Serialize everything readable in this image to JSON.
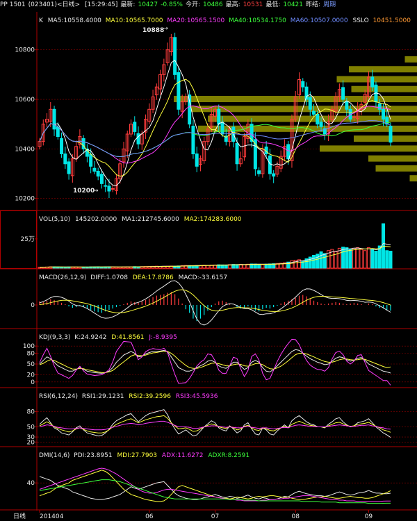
{
  "header": {
    "code": "PP  1501",
    "sub": "(023401)<日线>",
    "time": "[15:29:45]",
    "latest_label": "最新:",
    "latest": "10427",
    "change": "-0.85%",
    "open_label": "今开:",
    "open": "10486",
    "high_label": "最高:",
    "high": "10531",
    "low_label": "最低:",
    "low": "10421",
    "prev_label": "昨结:",
    "prev": "周期"
  },
  "colors": {
    "up": "#ff3c3c",
    "down": "#00e6e6",
    "ma5": "#ffffff",
    "ma10": "#ffff3c",
    "ma20": "#ff3cff",
    "ma40": "#3cff3c",
    "ma60": "#6f8cff",
    "grid": "#8b0000",
    "frame": "#b00000",
    "volume_profile": "#7f7f00"
  },
  "chart_data": [
    {
      "type": "candlestick",
      "legend": {
        "k": "K",
        "ma5": "MA5:10558.4000",
        "ma10": "MA10:10565.7000",
        "ma20": "MA20:10565.1500",
        "ma40": "MA40:10534.1750",
        "ma60": "MA60:10507.0000",
        "sslo": "SSLO",
        "sslo_value": "10451.5000"
      },
      "ylim": [
        10160,
        10900
      ],
      "yticks": [
        "10800",
        "10600",
        "10400",
        "10200"
      ],
      "ytick_values": [
        10800,
        10600,
        10400,
        10200
      ],
      "annotations": {
        "high": "10888",
        "high_value": 10888,
        "low": "10200",
        "low_value": 10200
      },
      "close_path": [
        10430,
        10500,
        10520,
        10560,
        10480,
        10450,
        10380,
        10340,
        10300,
        10360,
        10410,
        10450,
        10400,
        10370,
        10330,
        10310,
        10290,
        10260,
        10250,
        10230,
        10240,
        10280,
        10340,
        10400,
        10460,
        10500,
        10470,
        10420,
        10460,
        10520,
        10560,
        10610,
        10650,
        10700,
        10740,
        10800,
        10850,
        10700,
        10560,
        10590,
        10610,
        10500,
        10380,
        10330,
        10360,
        10430,
        10480,
        10540,
        10560,
        10500,
        10460,
        10430,
        10480,
        10430,
        10340,
        10360,
        10450,
        10500,
        10430,
        10320,
        10300,
        10400,
        10380,
        10300,
        10290,
        10330,
        10370,
        10410,
        10360,
        10520,
        10610,
        10680,
        10650,
        10600,
        10560,
        10540,
        10500,
        10490,
        10460,
        10510,
        10560,
        10610,
        10640,
        10600,
        10560,
        10520,
        10530,
        10560,
        10580,
        10620,
        10690,
        10650,
        10590,
        10560,
        10520,
        10500,
        10427
      ],
      "vol_profile_prices": [
        10760,
        10720,
        10680,
        10640,
        10600,
        10560,
        10520,
        10480,
        10440,
        10400,
        10360,
        10320,
        10280
      ],
      "vol_profile_lengths": [
        0.05,
        0.28,
        0.33,
        0.27,
        1.0,
        0.93,
        0.86,
        0.9,
        0.26,
        0.4,
        0.2,
        0.17,
        0.03
      ]
    },
    {
      "type": "bar",
      "legend": {
        "name": "VOL(5,10)",
        "value": "145202.0000",
        "ma1": "MA1:212745.6000",
        "ma2": "MA2:174283.6000"
      },
      "ylim": [
        0,
        380000
      ],
      "yticks": [
        "25万"
      ],
      "ytick_values": [
        250000
      ],
      "volumes": [
        8000,
        9000,
        10000,
        12000,
        11000,
        10000,
        9000,
        9000,
        10000,
        10000,
        10000,
        9000,
        9000,
        10000,
        11000,
        11000,
        12000,
        10000,
        11000,
        12000,
        11000,
        10000,
        9000,
        11000,
        12000,
        11000,
        13000,
        12000,
        13000,
        14000,
        15000,
        16000,
        17000,
        15000,
        16000,
        17000,
        18000,
        17000,
        19000,
        22000,
        23000,
        22000,
        21000,
        22000,
        23000,
        25000,
        24000,
        26000,
        27000,
        29000,
        28000,
        27000,
        30000,
        32000,
        31000,
        33000,
        30000,
        34000,
        36000,
        35000,
        33000,
        30000,
        34000,
        36000,
        38000,
        40000,
        42000,
        46000,
        52000,
        64000,
        68000,
        72000,
        60000,
        80000,
        95000,
        110000,
        120000,
        140000,
        125000,
        150000,
        160000,
        140000,
        170000,
        180000,
        175000,
        160000,
        170000,
        175000,
        160000,
        150000,
        175000,
        160000,
        145000,
        190000,
        380000,
        150000,
        145202
      ]
    },
    {
      "type": "bar",
      "legend": {
        "name": "MACD(26,12,9)",
        "diff": "DIFF:1.0708",
        "dea": "DEA:17.8786",
        "macd": "MACD:-33.6157"
      },
      "ylim": [
        -60,
        60
      ],
      "yticks": [
        "0"
      ],
      "ytick_values": [
        0
      ],
      "macd": [
        10,
        8,
        12,
        16,
        14,
        10,
        6,
        2,
        -4,
        -8,
        -6,
        -2,
        -6,
        -10,
        -14,
        -18,
        -20,
        -22,
        -18,
        -14,
        -10,
        -6,
        -2,
        2,
        6,
        10,
        8,
        6,
        10,
        14,
        18,
        22,
        26,
        28,
        30,
        34,
        36,
        30,
        18,
        4,
        -12,
        -22,
        -38,
        -45,
        -38,
        -28,
        -16,
        -6,
        4,
        10,
        12,
        8,
        4,
        0,
        -6,
        -10,
        -8,
        -4,
        -10,
        -16,
        -18,
        -12,
        -8,
        -10,
        -6,
        -2,
        4,
        8,
        12,
        16,
        20,
        26,
        28,
        24,
        18,
        12,
        8,
        4,
        2,
        4,
        6,
        8,
        6,
        4,
        2,
        4,
        6,
        4,
        2,
        0,
        4,
        2,
        -4,
        -8,
        -10,
        -14,
        -16
      ]
    },
    {
      "type": "line",
      "legend": {
        "name": "KDJ(9,3,3)",
        "k": "K:24.9242",
        "d": "D:41.8561",
        "j": "J:-8.9395"
      },
      "ylim": [
        -10,
        110
      ],
      "yticks": [
        "100",
        "80",
        "50",
        "20",
        "0"
      ],
      "ytick_values": [
        100,
        80,
        50,
        20,
        0
      ],
      "k": [
        50,
        60,
        70,
        65,
        55,
        45,
        40,
        35,
        30,
        30,
        35,
        40,
        35,
        30,
        28,
        26,
        25,
        24,
        26,
        30,
        40,
        55,
        65,
        75,
        80,
        85,
        80,
        70,
        72,
        78,
        82,
        85,
        85,
        86,
        88,
        84,
        70,
        55,
        40,
        35,
        30,
        30,
        34,
        40,
        45,
        50,
        58,
        60,
        55,
        45,
        40,
        38,
        45,
        55,
        55,
        45,
        35,
        40,
        55,
        60,
        55,
        40,
        30,
        28,
        35,
        45,
        55,
        65,
        75,
        85,
        90,
        88,
        80,
        72,
        65,
        60,
        55,
        52,
        48,
        50,
        58,
        66,
        70,
        68,
        62,
        58,
        60,
        66,
        68,
        60,
        50,
        45,
        40,
        35,
        30,
        28,
        24.92
      ],
      "d": [
        48,
        52,
        58,
        62,
        60,
        55,
        50,
        45,
        40,
        36,
        36,
        38,
        37,
        34,
        32,
        30,
        28,
        26,
        26,
        28,
        32,
        40,
        48,
        56,
        64,
        72,
        76,
        74,
        73,
        75,
        78,
        81,
        82,
        84,
        85,
        85,
        80,
        72,
        62,
        54,
        46,
        40,
        38,
        38,
        40,
        44,
        48,
        52,
        53,
        51,
        48,
        45,
        45,
        48,
        50,
        49,
        45,
        44,
        47,
        51,
        52,
        48,
        42,
        37,
        36,
        39,
        44,
        51,
        59,
        68,
        76,
        80,
        80,
        78,
        74,
        70,
        65,
        61,
        57,
        55,
        55,
        58,
        62,
        64,
        64,
        62,
        61,
        62,
        64,
        63,
        59,
        55,
        51,
        47,
        43,
        40,
        41.86
      ],
      "j": [
        54,
        76,
        94,
        71,
        45,
        25,
        20,
        15,
        10,
        18,
        33,
        44,
        31,
        22,
        20,
        18,
        19,
        20,
        26,
        34,
        56,
        85,
        99,
        113,
        112,
        111,
        88,
        62,
        70,
        84,
        90,
        93,
        91,
        90,
        94,
        82,
        50,
        21,
        -4,
        -3,
        -2,
        10,
        26,
        44,
        55,
        62,
        78,
        76,
        59,
        33,
        24,
        24,
        45,
        69,
        65,
        37,
        15,
        32,
        71,
        78,
        61,
        24,
        6,
        10,
        33,
        57,
        77,
        93,
        107,
        119,
        118,
        104,
        80,
        60,
        47,
        40,
        35,
        34,
        30,
        40,
        64,
        82,
        86,
        76,
        58,
        50,
        58,
        74,
        76,
        54,
        32,
        25,
        18,
        11,
        4,
        4,
        -8.94
      ]
    },
    {
      "type": "line",
      "legend": {
        "name": "RSI(6,12,24)",
        "rsi1": "RSI1:29.1231",
        "rsi2": "RSI2:39.2596",
        "rsi3": "RSI3:45.5936"
      },
      "ylim": [
        15,
        100
      ],
      "yticks": [
        "80",
        "50",
        "30",
        "20"
      ],
      "ytick_values": [
        80,
        50,
        30,
        20
      ],
      "rsi1": [
        55,
        62,
        68,
        58,
        48,
        44,
        38,
        36,
        34,
        40,
        48,
        52,
        44,
        38,
        36,
        34,
        32,
        33,
        38,
        45,
        55,
        62,
        66,
        70,
        74,
        76,
        68,
        60,
        66,
        72,
        76,
        78,
        80,
        82,
        84,
        74,
        58,
        46,
        36,
        40,
        44,
        38,
        32,
        34,
        42,
        50,
        56,
        62,
        58,
        48,
        44,
        42,
        52,
        46,
        38,
        42,
        54,
        58,
        46,
        36,
        34,
        48,
        44,
        36,
        34,
        42,
        48,
        54,
        48,
        62,
        68,
        72,
        66,
        60,
        56,
        54,
        50,
        50,
        48,
        55,
        60,
        66,
        68,
        60,
        54,
        50,
        52,
        58,
        60,
        62,
        66,
        58,
        50,
        44,
        38,
        34,
        29.12
      ],
      "rsi2": [
        52,
        56,
        60,
        56,
        50,
        47,
        44,
        42,
        40,
        42,
        46,
        48,
        45,
        42,
        40,
        39,
        38,
        38,
        40,
        44,
        50,
        55,
        58,
        61,
        64,
        66,
        62,
        58,
        61,
        64,
        66,
        68,
        70,
        71,
        72,
        67,
        58,
        52,
        46,
        47,
        48,
        45,
        41,
        42,
        46,
        50,
        53,
        56,
        54,
        50,
        48,
        47,
        51,
        48,
        44,
        46,
        51,
        53,
        48,
        44,
        43,
        48,
        46,
        43,
        42,
        45,
        48,
        51,
        48,
        55,
        58,
        61,
        58,
        55,
        53,
        52,
        50,
        50,
        49,
        52,
        55,
        58,
        59,
        56,
        53,
        51,
        52,
        55,
        56,
        57,
        59,
        55,
        51,
        48,
        44,
        42,
        39.26
      ],
      "rsi3": [
        50,
        52,
        54,
        53,
        51,
        49,
        48,
        47,
        46,
        46,
        47,
        48,
        47,
        46,
        45,
        44,
        44,
        44,
        45,
        47,
        49,
        51,
        53,
        55,
        56,
        57,
        56,
        54,
        55,
        57,
        58,
        59,
        60,
        61,
        61,
        59,
        56,
        53,
        50,
        50,
        50,
        49,
        47,
        47,
        48,
        50,
        51,
        52,
        52,
        51,
        50,
        49,
        50,
        49,
        48,
        48,
        50,
        51,
        49,
        48,
        47,
        48,
        48,
        47,
        46,
        47,
        48,
        49,
        48,
        51,
        53,
        54,
        53,
        52,
        51,
        51,
        50,
        50,
        50,
        51,
        52,
        53,
        54,
        53,
        52,
        51,
        51,
        52,
        53,
        53,
        54,
        52,
        51,
        49,
        48,
        46,
        45.59
      ]
    },
    {
      "type": "line",
      "legend": {
        "name": "DMI(14,6)",
        "pdi": "PDI:23.8951",
        "mdi": "MDI:27.7903",
        "adx": "ADX:11.6272",
        "adxr": "ADXR:8.2591"
      },
      "ylim": [
        0,
        75
      ],
      "yticks": [
        "40"
      ],
      "ytick_values": [
        40
      ],
      "pdi": [
        50,
        48,
        46,
        44,
        40,
        36,
        34,
        32,
        30,
        26,
        24,
        22,
        20,
        18,
        16,
        15,
        14,
        14,
        15,
        16,
        18,
        20,
        22,
        26,
        30,
        34,
        32,
        30,
        32,
        34,
        36,
        38,
        40,
        41,
        42,
        36,
        30,
        24,
        20,
        18,
        16,
        15,
        14,
        14,
        15,
        17,
        18,
        20,
        22,
        20,
        18,
        17,
        19,
        18,
        16,
        17,
        19,
        21,
        18,
        16,
        15,
        17,
        16,
        14,
        14,
        15,
        17,
        19,
        18,
        22,
        25,
        27,
        25,
        23,
        22,
        21,
        20,
        20,
        19,
        20,
        22,
        24,
        26,
        24,
        22,
        21,
        22,
        24,
        25,
        26,
        28,
        26,
        24,
        24,
        23,
        23,
        23.9
      ],
      "mdi": [
        20,
        22,
        24,
        26,
        30,
        34,
        36,
        38,
        40,
        44,
        46,
        48,
        50,
        52,
        54,
        56,
        58,
        60,
        58,
        54,
        48,
        42,
        36,
        30,
        26,
        22,
        20,
        18,
        16,
        14,
        13,
        12,
        11,
        11,
        12,
        16,
        22,
        28,
        34,
        36,
        34,
        32,
        30,
        28,
        26,
        24,
        22,
        20,
        18,
        17,
        16,
        16,
        15,
        16,
        18,
        17,
        16,
        15,
        16,
        18,
        19,
        18,
        19,
        20,
        20,
        19,
        18,
        17,
        18,
        16,
        15,
        14,
        14,
        15,
        16,
        17,
        18,
        18,
        19,
        18,
        17,
        16,
        16,
        17,
        18,
        19,
        18,
        17,
        17,
        16,
        16,
        17,
        19,
        21,
        23,
        25,
        27.79
      ],
      "adx": [
        30,
        32,
        34,
        36,
        38,
        40,
        42,
        44,
        46,
        48,
        50,
        52,
        54,
        56,
        58,
        60,
        62,
        63,
        62,
        60,
        57,
        54,
        50,
        46,
        42,
        38,
        34,
        30,
        27,
        25,
        24,
        24,
        25,
        27,
        29,
        30,
        30,
        29,
        28,
        27,
        26,
        25,
        24,
        23,
        22,
        21,
        20,
        19,
        18,
        17,
        16,
        15,
        14,
        14,
        13,
        13,
        12,
        12,
        12,
        12,
        12,
        13,
        13,
        14,
        14,
        15,
        15,
        16,
        16,
        17,
        18,
        19,
        20,
        20,
        20,
        19,
        18,
        17,
        16,
        15,
        14,
        14,
        13,
        13,
        12,
        12,
        12,
        11,
        11,
        11,
        11,
        11,
        11,
        11,
        11.5,
        11.6,
        11.63
      ],
      "adxr": [
        28,
        29,
        30,
        31,
        32,
        33,
        34,
        35,
        36,
        37,
        38,
        39,
        40,
        41,
        42,
        43,
        44,
        45,
        45,
        45,
        44,
        43,
        42,
        40,
        38,
        36,
        34,
        32,
        30,
        28,
        26,
        24,
        22,
        20,
        18,
        17,
        16,
        15,
        15,
        15,
        15,
        15,
        15,
        15,
        15,
        15,
        15,
        15,
        15,
        15,
        15,
        15,
        14,
        14,
        14,
        14,
        13,
        13,
        13,
        13,
        12,
        12,
        12,
        12,
        12,
        12,
        12,
        12,
        12,
        12,
        12,
        12,
        11,
        11,
        11,
        11,
        11,
        10,
        10,
        10,
        10,
        10,
        9,
        9,
        9,
        9,
        9,
        9,
        9,
        9,
        8,
        8,
        8,
        8,
        8.2,
        8.25,
        8.26
      ]
    }
  ],
  "xaxis": {
    "label": "日线",
    "ticks": [
      "201404",
      "06",
      "07",
      "08",
      "09"
    ],
    "tick_index": [
      0,
      30,
      48,
      70,
      90
    ]
  }
}
